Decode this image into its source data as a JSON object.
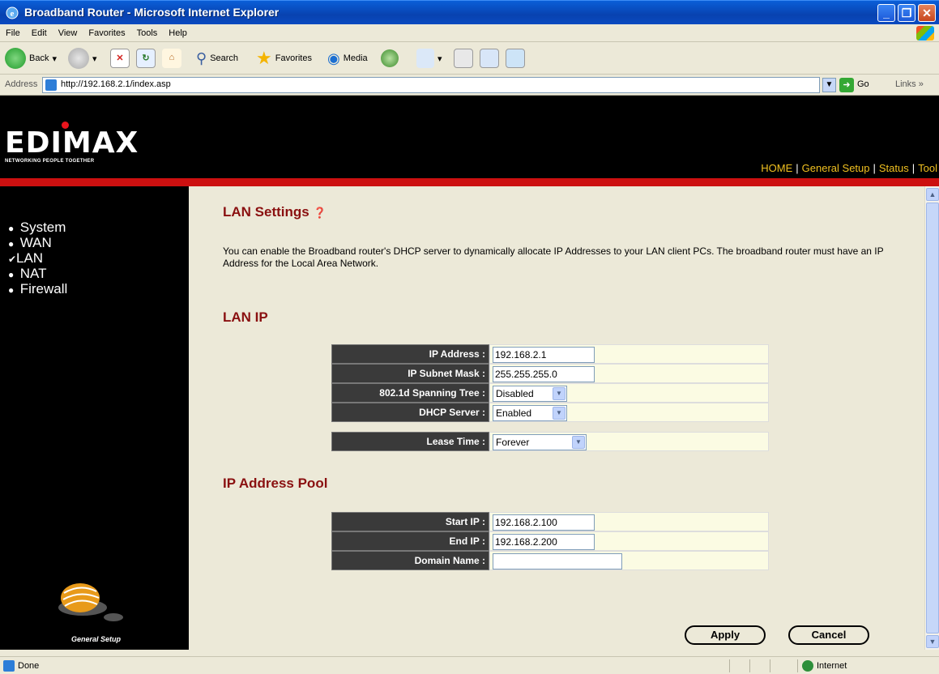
{
  "window": {
    "title": "Broadband Router - Microsoft Internet Explorer"
  },
  "menu": [
    "File",
    "Edit",
    "View",
    "Favorites",
    "Tools",
    "Help"
  ],
  "toolbar": {
    "back_label": "Back",
    "search_label": "Search",
    "favorites_label": "Favorites",
    "media_label": "Media"
  },
  "address": {
    "label": "Address",
    "url": "http://192.168.2.1/index.asp",
    "go_label": "Go",
    "links_label": "Links"
  },
  "header": {
    "logo": "EDIMAX",
    "tagline": "NETWORKING PEOPLE TOGETHER",
    "nav": [
      "HOME",
      "General Setup",
      "Status",
      "Tool"
    ]
  },
  "sidebar": {
    "items": [
      {
        "label": "System",
        "active": false
      },
      {
        "label": "WAN",
        "active": false
      },
      {
        "label": "LAN",
        "active": true
      },
      {
        "label": "NAT",
        "active": false
      },
      {
        "label": "Firewall",
        "active": false
      }
    ],
    "footer_label": "General Setup"
  },
  "content": {
    "title": "LAN Settings",
    "description": "You can enable the Broadband router's DHCP server to dynamically allocate IP Addresses to your LAN client PCs. The broadband router must have an IP Address for the Local Area Network.",
    "lan_ip": {
      "heading": "LAN IP",
      "ip_address_label": "IP Address :",
      "ip_address_value": "192.168.2.1",
      "subnet_label": "IP Subnet Mask :",
      "subnet_value": "255.255.255.0",
      "spanning_label": "802.1d Spanning Tree :",
      "spanning_value": "Disabled",
      "dhcp_label": "DHCP Server :",
      "dhcp_value": "Enabled",
      "lease_label": "Lease Time :",
      "lease_value": "Forever"
    },
    "pool": {
      "heading": "IP Address Pool",
      "start_label": "Start IP :",
      "start_value": "192.168.2.100",
      "end_label": "End IP :",
      "end_value": "192.168.2.200",
      "domain_label": "Domain Name :",
      "domain_value": ""
    },
    "apply_label": "Apply",
    "cancel_label": "Cancel"
  },
  "status": {
    "text": "Done",
    "zone": "Internet"
  },
  "colors": {
    "header_bg": "#000000",
    "red_bar": "#cc1010",
    "heading": "#8a1010",
    "nav_link": "#f0c020",
    "field_bg": "#fbfbe3",
    "label_bg": "#3a3a3a"
  }
}
